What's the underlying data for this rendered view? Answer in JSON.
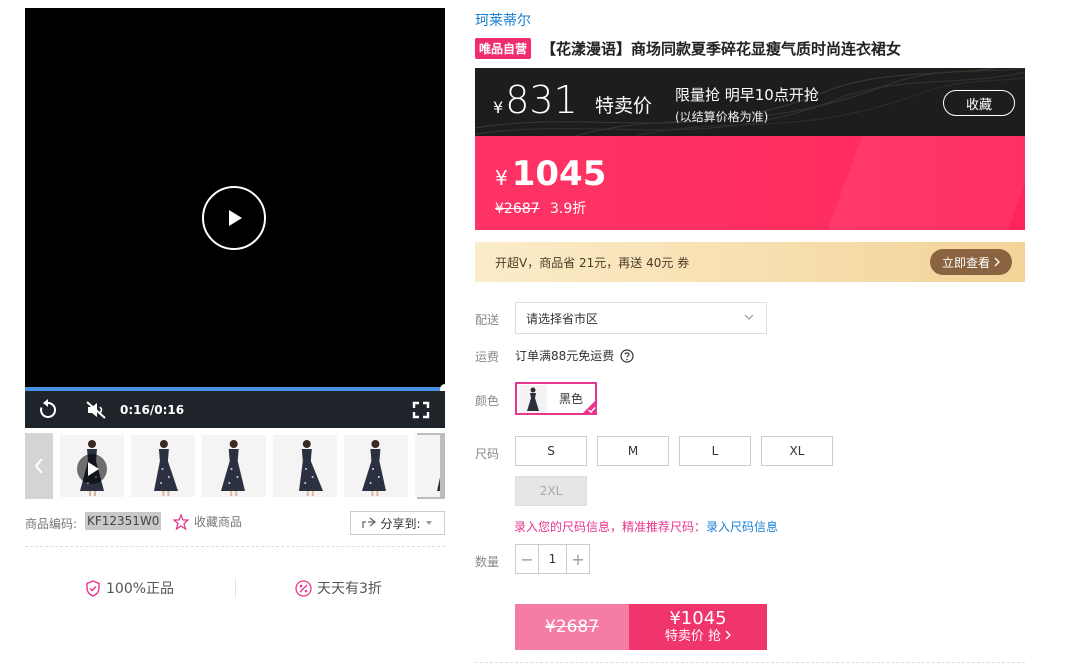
{
  "video": {
    "time": "0:16/0:16",
    "progress": 1.0,
    "accent_color": "#4a90e2"
  },
  "thumbnails": [
    {
      "kind": "video"
    },
    {
      "kind": "image"
    },
    {
      "kind": "image"
    },
    {
      "kind": "image"
    },
    {
      "kind": "image"
    },
    {
      "kind": "image"
    }
  ],
  "product_code": {
    "label": "商品编码:",
    "value": "KF12351W0"
  },
  "favorite_label": "收藏商品",
  "share_label": "分享到:",
  "assurances": [
    {
      "icon": "shield-check-icon",
      "label": "100%正品"
    },
    {
      "icon": "discount-icon",
      "label": "天天有3折"
    }
  ],
  "brand": "珂莱蒂尔",
  "vip_tag": "唯品自营",
  "title": "【花漾漫语】商场同款夏季碎花显瘦气质时尚连衣裙女",
  "promo": {
    "currency": "¥",
    "price": "831",
    "label": "特卖价",
    "limit_text": "限量抢 明早10点开抢",
    "note": "(以结算价格为准)",
    "collect_label": "收藏"
  },
  "sale": {
    "currency": "¥",
    "price": "1045",
    "original": "¥2687",
    "discount": "3.9折",
    "color": "#ff3366"
  },
  "vip_offer": {
    "text": "开超V，商品省 21元，再送 40元 券",
    "button_label": "立即查看"
  },
  "shipping": {
    "label": "配送",
    "placeholder": "请选择省市区"
  },
  "fee": {
    "label": "运费",
    "text": "订单满88元免运费"
  },
  "color": {
    "label": "颜色",
    "options": [
      {
        "name": "黑色",
        "selected": true
      }
    ]
  },
  "size": {
    "label": "尺码",
    "options": [
      {
        "name": "S",
        "disabled": false
      },
      {
        "name": "M",
        "disabled": false
      },
      {
        "name": "L",
        "disabled": false
      },
      {
        "name": "XL",
        "disabled": false
      },
      {
        "name": "2XL",
        "disabled": true
      }
    ],
    "tip_text": "录入您的尺码信息，精准推荐尺码：",
    "tip_link": "录入尺码信息"
  },
  "quantity": {
    "label": "数量",
    "value": "1",
    "minus": "−",
    "plus": "+"
  },
  "buy": {
    "original": "¥2687",
    "price": "¥1045",
    "label": "特卖价 抢"
  }
}
